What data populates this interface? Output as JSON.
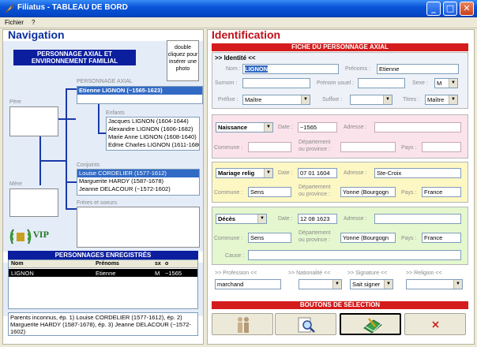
{
  "window": {
    "title": "Filiatus - TABLEAU DE BORD"
  },
  "menu": [
    "Fichier",
    "?"
  ],
  "navigation": {
    "title": "Navigation",
    "banner": "PERSONNAGE AXIAL ET ENVIRONNEMENT FAMILIAL",
    "hint": "double cliquez pour insérer une photo",
    "pere_label": "Père",
    "mere_label": "Mère",
    "axial_label": "PERSONNAGE AXIAL",
    "axial_name": "Etienne LIGNON (~1565-1623)",
    "enfants_label": "Enfants",
    "enfants": [
      "Jacques LIGNON (1604-1644)",
      "Alexandre LIGNON (1606-1682)",
      "Marie Anne LIGNON (1608-1640)",
      "Edme Charles LIGNON (1611-1680)"
    ],
    "conjoints_label": "Conjoints",
    "conjoints": [
      "Louise CORDELIER (1577-1612)",
      "Marguerite HARDY (1587-1678)",
      "Jeanne DELACOUR (~1572-1602)"
    ],
    "freres_label": "Frères et soeurs",
    "vip_label": "VIP"
  },
  "registered": {
    "title": "PERSONNAGES ENREGISTRÉS",
    "columns": [
      "Nom",
      "Prénoms",
      "sx",
      "o"
    ],
    "rows": [
      [
        "LIGNON",
        "Etienne",
        "M",
        "~1565"
      ]
    ],
    "footer": "Parents inconnus, ép. 1) Louise CORDELIER (1577-1612), ép. 2) Marguerite HARDY (1587-1678), ép. 3) Jeanne DELACOUR (~1572-1602)"
  },
  "identification": {
    "title": "Identification",
    "fiche_title": "FICHE DU PERSONNAGE AXIAL",
    "identite_label": ">> Identité <<",
    "nom_label": "Nom :",
    "nom_value": "LIGNON",
    "prenoms_label": "Prénoms :",
    "prenoms_value": "Etienne",
    "surnom_label": "Surnom :",
    "surnom_value": "",
    "prenom_usuel_label": "Prénom usuel :",
    "prenom_usuel_value": "",
    "sexe_label": "Sexe :",
    "sexe_value": "M",
    "prefixe_label": "Préfixe :",
    "prefixe_value": "Maître",
    "suffixe_label": "Suffixe :",
    "suffixe_value": "",
    "titres_label": "Titres :",
    "titres_value": "Maître",
    "naissance": {
      "event": "Naissance",
      "date_label": "Date :",
      "date": "~1565",
      "adresse_label": "Adresse :",
      "adresse": "",
      "commune_label": "Commune :",
      "commune": "",
      "dep_label_1": "Département",
      "dep_label_2": "ou province :",
      "departement": "",
      "pays_label": "Pays :",
      "pays": ""
    },
    "mariage": {
      "event": "Mariage relig",
      "date_label": "Date :",
      "date": "07 01 1604",
      "adresse_label": "Adresse :",
      "adresse": "Ste-Croix",
      "commune_label": "Commune :",
      "commune": "Sens",
      "dep_label_1": "Département",
      "dep_label_2": "ou province :",
      "departement": "Yonne (Bourgogn",
      "pays_label": "Pays :",
      "pays": "France"
    },
    "deces": {
      "event": "Décès",
      "date_label": "Date :",
      "date": "12 08 1623",
      "adresse_label": "Adresse :",
      "adresse": "",
      "commune_label": "Commune :",
      "commune": "Sens",
      "dep_label_1": "Département",
      "dep_label_2": "ou province :",
      "departement": "Yonne (Bourgogn",
      "pays_label": "Pays :",
      "pays": "France",
      "cause_label": "Cause :",
      "cause": ""
    },
    "profession_label": ">> Profession <<",
    "profession": "marchand",
    "nationalite_label": ">> Nationalité <<",
    "nationalite": "",
    "signature_label": ">> Signature <<",
    "signature": "Sait signer",
    "religion_label": ">> Religion <<",
    "religion": ""
  },
  "selection": {
    "title": "BOUTONS DE SÉLECTION"
  },
  "icons": [
    "app-feather-icon",
    "minimize-icon",
    "maximize-icon",
    "close-icon",
    "couple-icon",
    "search-icon",
    "book-pen-icon",
    "delete-x-icon",
    "vip-laurel-icon"
  ]
}
